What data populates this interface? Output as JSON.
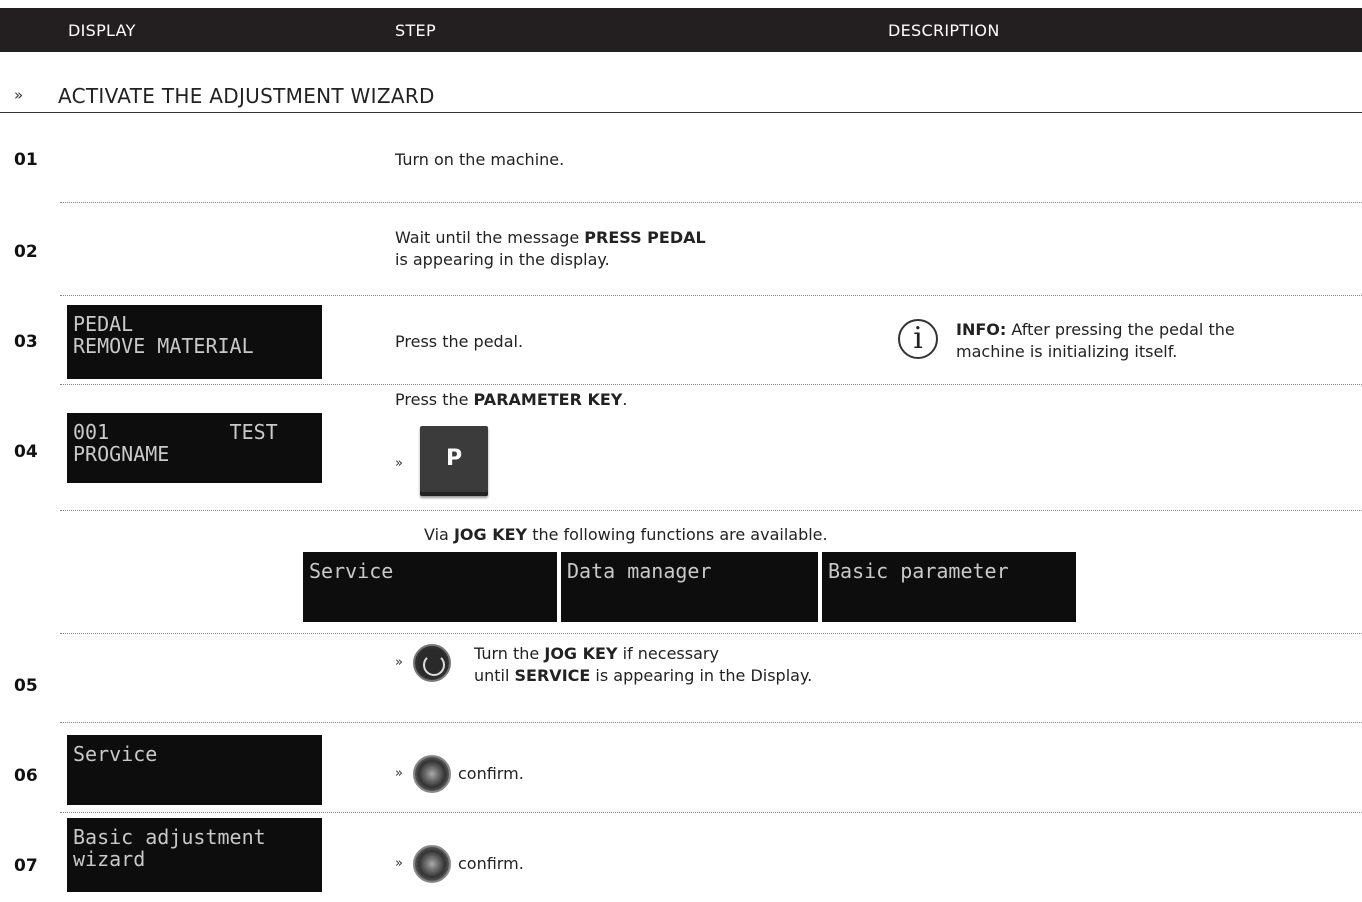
{
  "header": {
    "col_display": "DISPLAY",
    "col_step": "STEP",
    "col_description": "DESCRIPTION"
  },
  "section": {
    "marker": "»",
    "title": "ACTIVATE THE ADJUSTMENT WIZARD"
  },
  "steps": [
    {
      "num": "01",
      "text": "Turn on the machine."
    },
    {
      "num": "02",
      "text_a": "Wait until the message ",
      "bold": "PRESS PEDAL",
      "text_b": "is appearing in the display."
    },
    {
      "num": "03",
      "display_line1": "PEDAL",
      "display_line2": "REMOVE MATERIAL",
      "text": "Press the pedal.",
      "info_icon": "info-icon",
      "info_label": "INFO:",
      "info_text_a": " After pressing the pedal the",
      "info_text_b": "machine is initializing itself."
    },
    {
      "num": "04",
      "display_line1": "001          TEST",
      "display_line2": "PROGNAME",
      "text_a": "Press the ",
      "bold": "PARAMETER KEY",
      "text_b": ".",
      "arrow": "»",
      "key_label": "P"
    },
    {
      "num": "05",
      "arrow": "»",
      "text_a": "Turn the ",
      "bold": "JOG KEY",
      "text_b": " if necessary",
      "text_c": "until ",
      "bold2": "SERVICE",
      "text_d": " is appearing in the Display."
    },
    {
      "num": "06",
      "display_line1": "Service",
      "arrow": "»",
      "text": "confirm."
    },
    {
      "num": "07",
      "display_line1": "Basic adjustment",
      "display_line2": "wizard",
      "arrow": "»",
      "text": "confirm."
    }
  ],
  "jog_info": {
    "text_a": "Via ",
    "bold": "JOG KEY",
    "text_b": " the following functions are available.",
    "options": [
      "Service",
      "Data manager",
      "Basic parameter"
    ]
  }
}
